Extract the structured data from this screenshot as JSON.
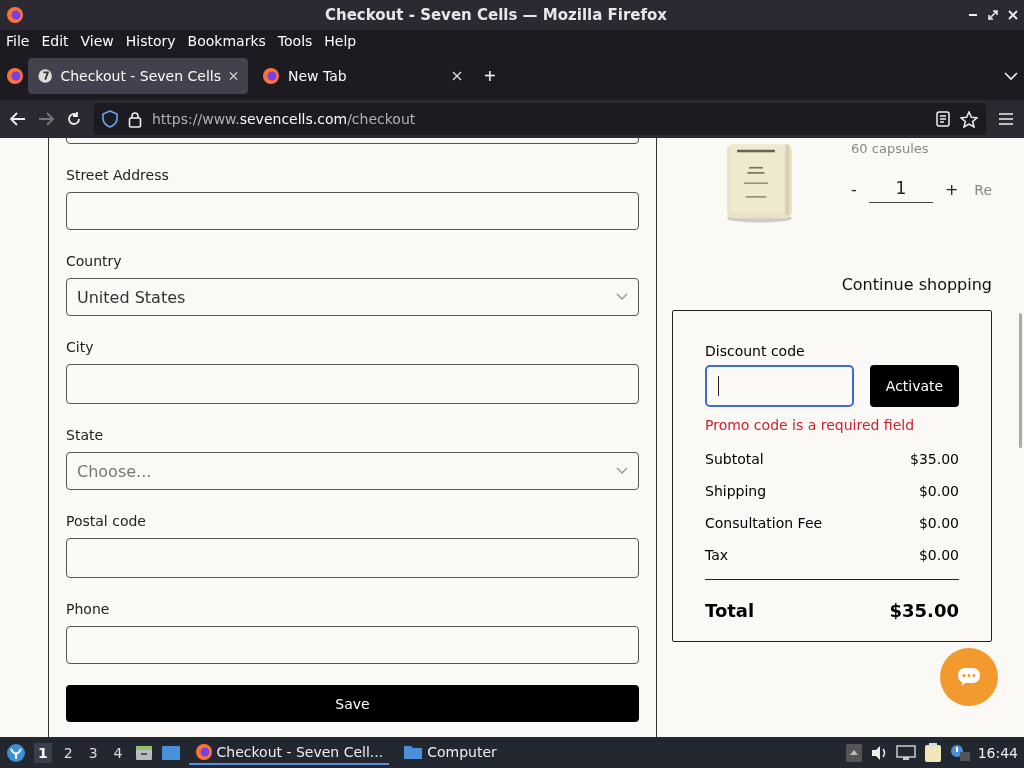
{
  "window": {
    "title": "Checkout - Seven Cells — Mozilla Firefox"
  },
  "menu": [
    "File",
    "Edit",
    "View",
    "History",
    "Bookmarks",
    "Tools",
    "Help"
  ],
  "tabs": [
    {
      "title": "Checkout - Seven Cells",
      "selected": true,
      "kind": "site"
    },
    {
      "title": "New Tab",
      "selected": false,
      "kind": "firefox"
    }
  ],
  "new_tab": "+",
  "url": [
    {
      "text": "https://www.",
      "emphasis": false
    },
    {
      "text": "sevencells.com",
      "emphasis": true
    },
    {
      "text": "/checkout",
      "emphasis": false
    }
  ],
  "form": {
    "fields": [
      {
        "kind": "text"
      },
      {
        "kind": "text",
        "label": "Street Address"
      },
      {
        "kind": "select",
        "label": "Country",
        "value": "United States"
      },
      {
        "kind": "text",
        "label": "City"
      },
      {
        "kind": "select",
        "label": "State",
        "placeholder": "Choose..."
      },
      {
        "kind": "text",
        "label": "Postal code"
      },
      {
        "kind": "text",
        "label": "Phone"
      }
    ],
    "save": "Save"
  },
  "product": {
    "details": "60 capsules",
    "minus": "-",
    "quantity": "1",
    "plus": "+",
    "remove": "Re"
  },
  "continue": "Continue shopping",
  "summary": {
    "discount_label": "Discount code",
    "discount_focused": true,
    "activate": "Activate",
    "error": "Promo code is a required field",
    "lines": [
      {
        "label": "Subtotal",
        "amount": "$35.00"
      },
      {
        "label": "Shipping",
        "amount": "$0.00"
      },
      {
        "label": "Consultation Fee",
        "amount": "$0.00"
      },
      {
        "label": "Tax",
        "amount": "$0.00"
      }
    ],
    "total": {
      "label": "Total",
      "amount": "$35.00"
    }
  },
  "taskbar": {
    "workspaces": [
      {
        "label": "1",
        "selected": true
      },
      {
        "label": "2",
        "selected": false
      },
      {
        "label": "3",
        "selected": false
      },
      {
        "label": "4",
        "selected": false
      }
    ],
    "tasks": [
      {
        "title": "Checkout - Seven Cell...",
        "selected": true,
        "kind": "firefox"
      },
      {
        "title": "Computer",
        "selected": false,
        "kind": "folder"
      }
    ],
    "clock": "16:44"
  }
}
